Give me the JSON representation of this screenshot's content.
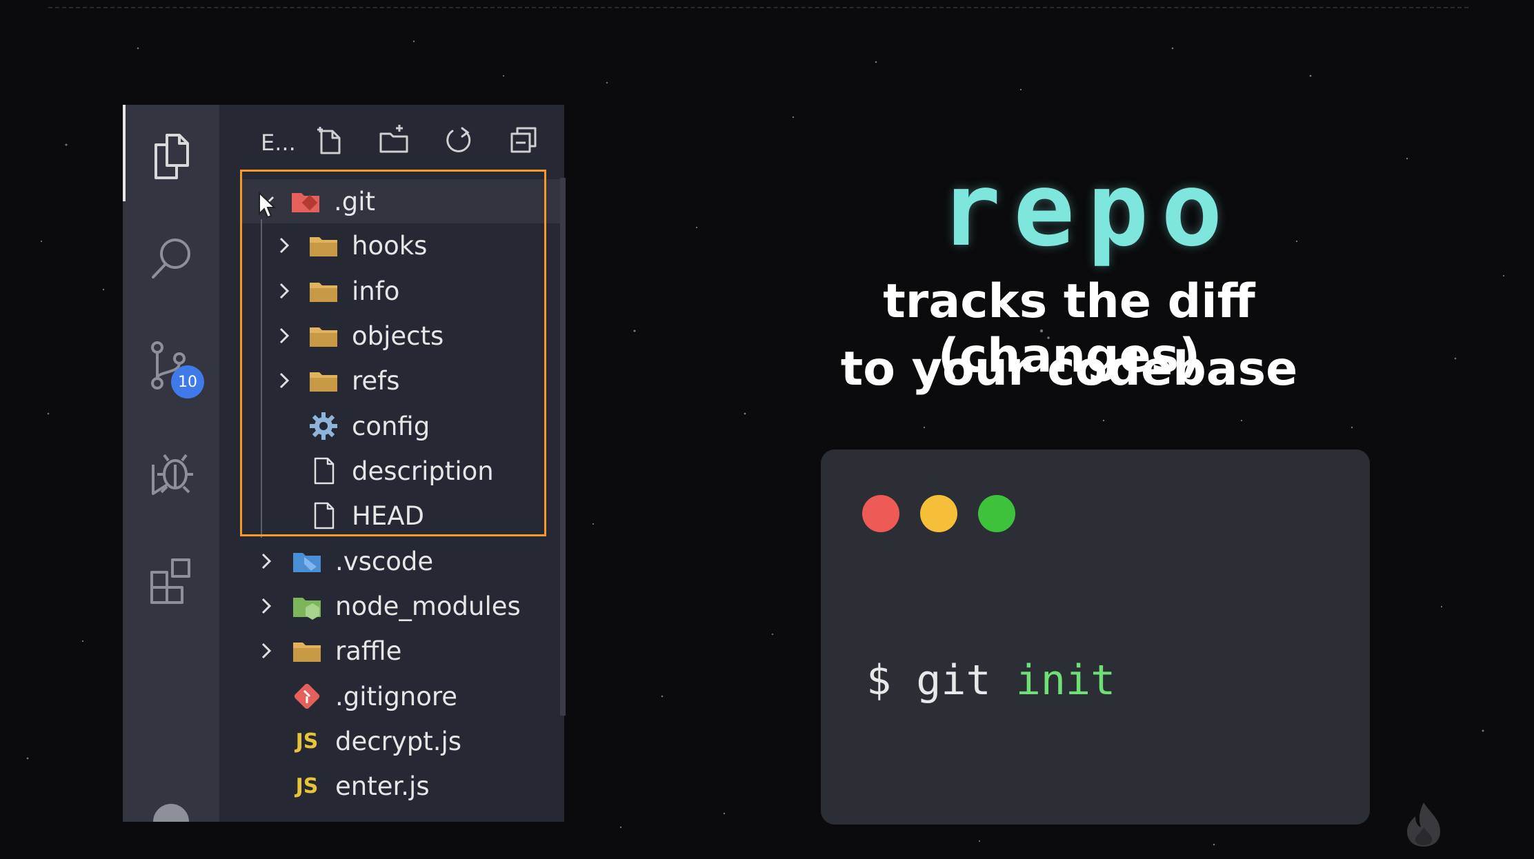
{
  "explorer": {
    "title": "E...",
    "header_buttons": [
      "new-file-icon",
      "new-folder-icon",
      "refresh-icon",
      "collapse-all-icon"
    ]
  },
  "activity_bar": {
    "items": [
      "explorer-icon",
      "search-icon",
      "source-control-icon",
      "debug-icon",
      "extensions-icon"
    ],
    "source_control_badge": "10"
  },
  "tree": {
    "git": ".git",
    "git_children": [
      "hooks",
      "info",
      "objects",
      "refs",
      "config",
      "description",
      "HEAD"
    ],
    "root_items": [
      ".vscode",
      "node_modules",
      "raffle",
      ".gitignore",
      "decrypt.js",
      "enter.js"
    ],
    "js_label": "JS"
  },
  "headline": {
    "title": "repo",
    "line1": "tracks the diff (changes)",
    "line2": "to your codebase"
  },
  "terminal": {
    "prompt": "$ git ",
    "keyword": "init",
    "dot_colors": [
      "#ee5a55",
      "#f5bf3a",
      "#3ec23c"
    ]
  },
  "colors": {
    "highlight": "#f49a2b",
    "title": "#7ee6dd",
    "keyword": "#6fe075"
  }
}
